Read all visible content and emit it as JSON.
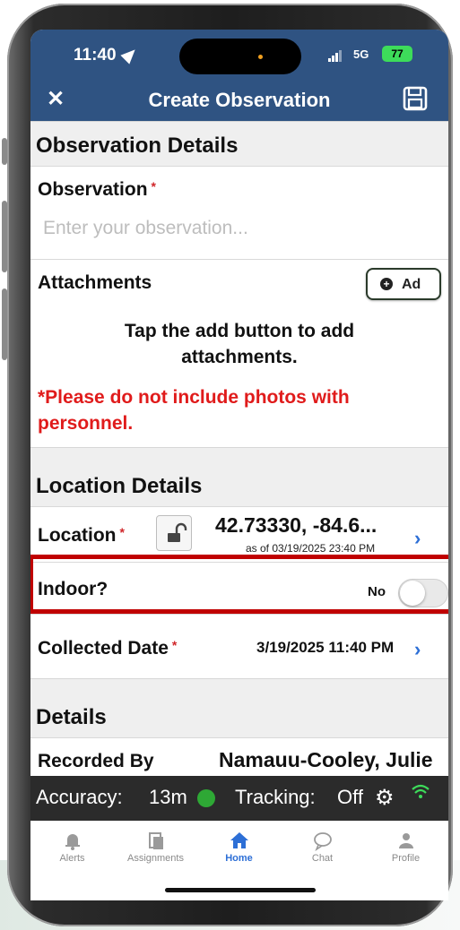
{
  "status_bar": {
    "time": "11:40",
    "network": "5G",
    "battery": "77"
  },
  "header": {
    "title": "Create Observation"
  },
  "observation_details": {
    "heading": "Observation Details",
    "observation_label": "Observation",
    "required_mark": "*",
    "observation_placeholder": "Enter your observation...",
    "attachments_label": "Attachments",
    "add_label": "Ad",
    "attachments_hint": "Tap the add button to add attachments.",
    "photo_warning": "*Please do not include photos with personnel."
  },
  "location_details": {
    "heading": "Location Details",
    "location_label": "Location",
    "coordinates": "42.73330, -84.6...",
    "as_of": "as of 03/19/2025 23:40 PM",
    "indoor_label": "Indoor?",
    "indoor_value": "No",
    "indoor_toggle_on": false,
    "collected_label": "Collected Date",
    "collected_value": "3/19/2025 11:40 PM"
  },
  "details": {
    "heading": "Details",
    "recorded_by_label": "Recorded By",
    "recorded_by_value": "Namauu-Cooley, Julie"
  },
  "accuracy_bar": {
    "accuracy_label": "Accuracy:",
    "accuracy_value": "13m",
    "tracking_label": "Tracking:",
    "tracking_value": "Off"
  },
  "tabs": [
    {
      "label": "Alerts",
      "icon": "bell-icon"
    },
    {
      "label": "Assignments",
      "icon": "clipboard-icon"
    },
    {
      "label": "Home",
      "icon": "home-icon"
    },
    {
      "label": "Chat",
      "icon": "chat-bubble-icon"
    },
    {
      "label": "Profile",
      "icon": "person-icon"
    }
  ],
  "colors": {
    "header_bg": "#2f5382",
    "accent": "#2d6fd6",
    "warning": "#e01b1b",
    "highlight": "#c00000",
    "accuracy_ok": "#2ea835"
  }
}
